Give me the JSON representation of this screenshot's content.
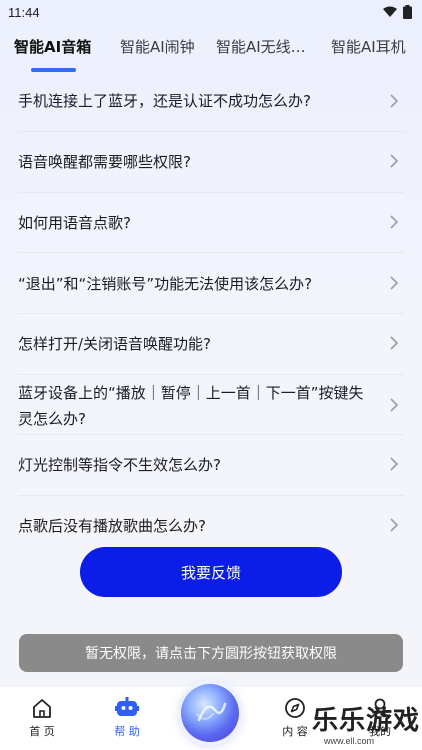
{
  "status_bar": {
    "time": "11:44"
  },
  "tabs": [
    {
      "label": "智能AI音箱",
      "active": true
    },
    {
      "label": "智能AI闹钟",
      "active": false
    },
    {
      "label": "智能AI无线…",
      "active": false
    },
    {
      "label": "智能AI耳机",
      "active": false
    }
  ],
  "faq": [
    {
      "question": "手机连接上了蓝牙，还是认证不成功怎么办?"
    },
    {
      "question": "语音唤醒都需要哪些权限?"
    },
    {
      "question": "如何用语音点歌?"
    },
    {
      "question": "“退出”和“注销账号”功能无法使用该怎么办?"
    },
    {
      "question": "怎样打开/关闭语音唤醒功能?"
    },
    {
      "question": "蓝牙设备上的“播放｜暂停｜上一首｜下一首”按键失灵怎么办?"
    },
    {
      "question": "灯光控制等指令不生效怎么办?"
    },
    {
      "question": "点歌后没有播放歌曲怎么办?"
    }
  ],
  "feedback_button": {
    "label": "我要反馈"
  },
  "permission_notice": {
    "text": "暂无权限，请点击下方圆形按钮获取权限"
  },
  "bottom_nav": {
    "home": {
      "label": "首 页"
    },
    "help": {
      "label": "帮 助"
    },
    "content": {
      "label": "内 容"
    },
    "mine": {
      "label": "我的"
    }
  },
  "watermark": {
    "title": "乐乐游戏",
    "url": "www.ell.com"
  },
  "colors": {
    "accent": "#2f6df6",
    "button": "#0c1de8",
    "notice": "#8a8a8a"
  }
}
